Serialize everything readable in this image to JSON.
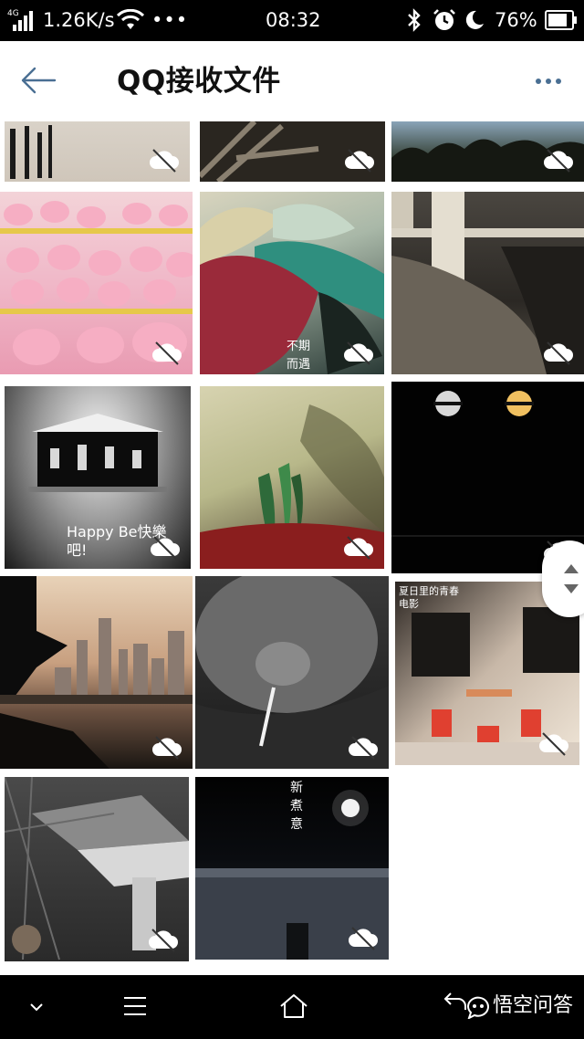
{
  "status_bar": {
    "network": "4G",
    "speed": "1.26K/s",
    "dots": "•••",
    "time": "08:32",
    "battery": "76%"
  },
  "app_bar": {
    "title": "QQ接收文件"
  },
  "tiles": [
    {
      "caption": "Happy Be快樂吧!"
    },
    {
      "caption": "不期 而遇"
    },
    {
      "caption": "夏日里的青春电影"
    },
    {
      "caption": "新 煮 意"
    }
  ],
  "watermark": {
    "text": "悟空问答"
  }
}
